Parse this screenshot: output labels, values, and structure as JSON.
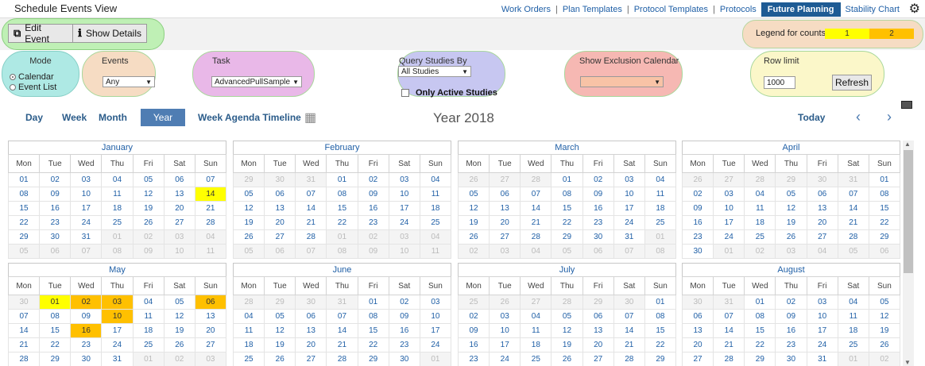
{
  "app": {
    "title": "Schedule Events View"
  },
  "nav": {
    "items": [
      {
        "label": "Work Orders"
      },
      {
        "label": "Plan Templates"
      },
      {
        "label": "Protocol Templates"
      },
      {
        "label": "Protocols"
      },
      {
        "label": "Future Planning"
      },
      {
        "label": "Stability Chart"
      }
    ],
    "separator": "|",
    "active_index": 4,
    "gear_icon": "gear-icon"
  },
  "toolbar": {
    "edit_label": "Edit Event",
    "details_label": "Show Details",
    "edit_icon": "edit-icon",
    "info_icon": "info-icon",
    "legend_label": "Legend for counts:",
    "legend_1": "1",
    "legend_2": "2",
    "colors": {
      "count1": "#ffff00",
      "count2": "#ffc000"
    }
  },
  "filters": {
    "mode": {
      "title": "Mode",
      "options": [
        "Calendar",
        "Event List"
      ],
      "selected": "Calendar"
    },
    "events": {
      "title": "Events",
      "value": "Any"
    },
    "task": {
      "title": "Task",
      "value": "AdvancedPullSample"
    },
    "query": {
      "title": "Query Studies By",
      "value": "All Studies",
      "active_label": "Only Active Studies"
    },
    "exclusion": {
      "title": "Show Exclusion Calendar",
      "value": ""
    },
    "rowlimit": {
      "title": "Row limit",
      "value": "1000",
      "refresh_label": "Refresh"
    }
  },
  "views": {
    "day": "Day",
    "week": "Week",
    "month": "Month",
    "year": "Year",
    "agenda": "Week Agenda Timeline",
    "today": "Today",
    "calendar_icon": "calendar-icon",
    "prev": "‹",
    "next": "›"
  },
  "calendar": {
    "title": "Year 2018",
    "weekdays": [
      "Mon",
      "Tue",
      "Wed",
      "Thu",
      "Fri",
      "Sat",
      "Sun"
    ],
    "months": [
      {
        "name": "January",
        "rows": [
          [
            "01",
            "02",
            "03",
            "04",
            "05",
            "06",
            "07"
          ],
          [
            "08",
            "09",
            "10",
            "11",
            "12",
            "13",
            "14"
          ],
          [
            "15",
            "16",
            "17",
            "18",
            "19",
            "20",
            "21"
          ],
          [
            "22",
            "23",
            "24",
            "25",
            "26",
            "27",
            "28"
          ],
          [
            "29",
            "30",
            "31",
            "01",
            "02",
            "03",
            "04"
          ],
          [
            "05",
            "06",
            "07",
            "08",
            "09",
            "10",
            "11"
          ]
        ],
        "out": [
          [
            4,
            3
          ],
          [
            4,
            4
          ],
          [
            4,
            5
          ],
          [
            4,
            6
          ],
          [
            5,
            0
          ],
          [
            5,
            1
          ],
          [
            5,
            2
          ],
          [
            5,
            3
          ],
          [
            5,
            4
          ],
          [
            5,
            5
          ],
          [
            5,
            6
          ]
        ],
        "c1": [
          [
            1,
            6
          ]
        ],
        "c2": []
      },
      {
        "name": "February",
        "rows": [
          [
            "29",
            "30",
            "31",
            "01",
            "02",
            "03",
            "04"
          ],
          [
            "05",
            "06",
            "07",
            "08",
            "09",
            "10",
            "11"
          ],
          [
            "12",
            "13",
            "14",
            "15",
            "16",
            "17",
            "18"
          ],
          [
            "19",
            "20",
            "21",
            "22",
            "23",
            "24",
            "25"
          ],
          [
            "26",
            "27",
            "28",
            "01",
            "02",
            "03",
            "04"
          ],
          [
            "05",
            "06",
            "07",
            "08",
            "09",
            "10",
            "11"
          ]
        ],
        "out": [
          [
            0,
            0
          ],
          [
            0,
            1
          ],
          [
            0,
            2
          ],
          [
            4,
            3
          ],
          [
            4,
            4
          ],
          [
            4,
            5
          ],
          [
            4,
            6
          ],
          [
            5,
            0
          ],
          [
            5,
            1
          ],
          [
            5,
            2
          ],
          [
            5,
            3
          ],
          [
            5,
            4
          ],
          [
            5,
            5
          ],
          [
            5,
            6
          ]
        ],
        "c1": [],
        "c2": []
      },
      {
        "name": "March",
        "rows": [
          [
            "26",
            "27",
            "28",
            "01",
            "02",
            "03",
            "04"
          ],
          [
            "05",
            "06",
            "07",
            "08",
            "09",
            "10",
            "11"
          ],
          [
            "12",
            "13",
            "14",
            "15",
            "16",
            "17",
            "18"
          ],
          [
            "19",
            "20",
            "21",
            "22",
            "23",
            "24",
            "25"
          ],
          [
            "26",
            "27",
            "28",
            "29",
            "30",
            "31",
            "01"
          ],
          [
            "02",
            "03",
            "04",
            "05",
            "06",
            "07",
            "08"
          ]
        ],
        "out": [
          [
            0,
            0
          ],
          [
            0,
            1
          ],
          [
            0,
            2
          ],
          [
            4,
            6
          ],
          [
            5,
            0
          ],
          [
            5,
            1
          ],
          [
            5,
            2
          ],
          [
            5,
            3
          ],
          [
            5,
            4
          ],
          [
            5,
            5
          ],
          [
            5,
            6
          ]
        ],
        "c1": [],
        "c2": []
      },
      {
        "name": "April",
        "rows": [
          [
            "26",
            "27",
            "28",
            "29",
            "30",
            "31",
            "01"
          ],
          [
            "02",
            "03",
            "04",
            "05",
            "06",
            "07",
            "08"
          ],
          [
            "09",
            "10",
            "11",
            "12",
            "13",
            "14",
            "15"
          ],
          [
            "16",
            "17",
            "18",
            "19",
            "20",
            "21",
            "22"
          ],
          [
            "23",
            "24",
            "25",
            "26",
            "27",
            "28",
            "29"
          ],
          [
            "30",
            "01",
            "02",
            "03",
            "04",
            "05",
            "06"
          ]
        ],
        "out": [
          [
            0,
            0
          ],
          [
            0,
            1
          ],
          [
            0,
            2
          ],
          [
            0,
            3
          ],
          [
            0,
            4
          ],
          [
            0,
            5
          ],
          [
            5,
            1
          ],
          [
            5,
            2
          ],
          [
            5,
            3
          ],
          [
            5,
            4
          ],
          [
            5,
            5
          ],
          [
            5,
            6
          ]
        ],
        "c1": [],
        "c2": []
      },
      {
        "name": "May",
        "rows": [
          [
            "30",
            "01",
            "02",
            "03",
            "04",
            "05",
            "06"
          ],
          [
            "07",
            "08",
            "09",
            "10",
            "11",
            "12",
            "13"
          ],
          [
            "14",
            "15",
            "16",
            "17",
            "18",
            "19",
            "20"
          ],
          [
            "21",
            "22",
            "23",
            "24",
            "25",
            "26",
            "27"
          ],
          [
            "28",
            "29",
            "30",
            "31",
            "01",
            "02",
            "03"
          ]
        ],
        "out": [
          [
            0,
            0
          ],
          [
            4,
            4
          ],
          [
            4,
            5
          ],
          [
            4,
            6
          ]
        ],
        "c1": [
          [
            0,
            1
          ]
        ],
        "c2": [
          [
            0,
            2
          ],
          [
            0,
            3
          ],
          [
            0,
            6
          ],
          [
            1,
            3
          ],
          [
            2,
            2
          ]
        ]
      },
      {
        "name": "June",
        "rows": [
          [
            "28",
            "29",
            "30",
            "31",
            "01",
            "02",
            "03"
          ],
          [
            "04",
            "05",
            "06",
            "07",
            "08",
            "09",
            "10"
          ],
          [
            "11",
            "12",
            "13",
            "14",
            "15",
            "16",
            "17"
          ],
          [
            "18",
            "19",
            "20",
            "21",
            "22",
            "23",
            "24"
          ],
          [
            "25",
            "26",
            "27",
            "28",
            "29",
            "30",
            "01"
          ]
        ],
        "out": [
          [
            0,
            0
          ],
          [
            0,
            1
          ],
          [
            0,
            2
          ],
          [
            0,
            3
          ],
          [
            4,
            6
          ]
        ],
        "c1": [],
        "c2": []
      },
      {
        "name": "July",
        "rows": [
          [
            "25",
            "26",
            "27",
            "28",
            "29",
            "30",
            "01"
          ],
          [
            "02",
            "03",
            "04",
            "05",
            "06",
            "07",
            "08"
          ],
          [
            "09",
            "10",
            "11",
            "12",
            "13",
            "14",
            "15"
          ],
          [
            "16",
            "17",
            "18",
            "19",
            "20",
            "21",
            "22"
          ],
          [
            "23",
            "24",
            "25",
            "26",
            "27",
            "28",
            "29"
          ]
        ],
        "out": [
          [
            0,
            0
          ],
          [
            0,
            1
          ],
          [
            0,
            2
          ],
          [
            0,
            3
          ],
          [
            0,
            4
          ],
          [
            0,
            5
          ]
        ],
        "c1": [],
        "c2": []
      },
      {
        "name": "August",
        "rows": [
          [
            "30",
            "31",
            "01",
            "02",
            "03",
            "04",
            "05"
          ],
          [
            "06",
            "07",
            "08",
            "09",
            "10",
            "11",
            "12"
          ],
          [
            "13",
            "14",
            "15",
            "16",
            "17",
            "18",
            "19"
          ],
          [
            "20",
            "21",
            "22",
            "23",
            "24",
            "25",
            "26"
          ],
          [
            "27",
            "28",
            "29",
            "30",
            "31",
            "01",
            "02"
          ]
        ],
        "out": [
          [
            0,
            0
          ],
          [
            0,
            1
          ],
          [
            4,
            5
          ],
          [
            4,
            6
          ]
        ],
        "c1": [],
        "c2": []
      }
    ]
  }
}
